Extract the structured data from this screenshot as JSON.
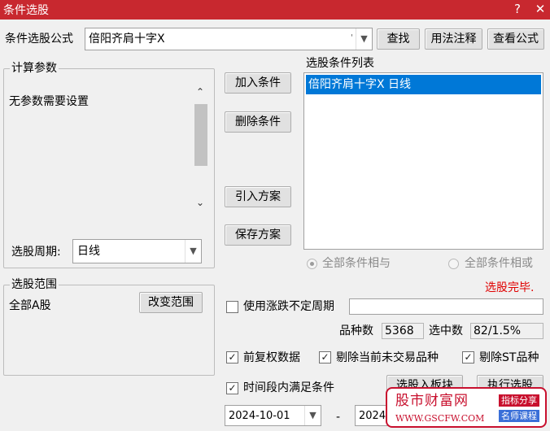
{
  "window": {
    "title": "条件选股",
    "help": "?",
    "close": "✕"
  },
  "formula": {
    "label": "条件选股公式",
    "value": "倍阳齐肩十字X",
    "find": "查找",
    "usage": "用法注释",
    "view": "查看公式"
  },
  "params": {
    "title": "计算参数",
    "text": "无参数需要设置",
    "period_label": "选股周期:",
    "period_value": "日线"
  },
  "actions": {
    "add": "加入条件",
    "remove": "删除条件",
    "import": "引入方案",
    "save": "保存方案"
  },
  "conditions": {
    "title": "选股条件列表",
    "items": [
      "倍阳齐肩十字X  日线"
    ],
    "and_label": "全部条件相与",
    "or_label": "全部条件相或",
    "status": "选股完毕."
  },
  "range": {
    "title": "选股范围",
    "value": "全部A股",
    "change": "改变范围"
  },
  "options": {
    "use_limit_period": "使用涨跌不定周期",
    "stock_count_label": "品种数",
    "stock_count": "5368",
    "selected_label": "选中数",
    "selected": "82/1.5%",
    "adjusted": "前复权数据",
    "remove_untraded": "剔除当前未交易品种",
    "remove_st": "剔除ST品种",
    "time_range": "时间段内满足条件",
    "to_block": "选股入板块",
    "execute": "执行选股",
    "date_from": "2024-10-01",
    "date_sep": "-",
    "date_to": "2024-"
  },
  "watermark": {
    "brand": "股市财富网",
    "url": "WWW.GSCFW.COM",
    "tag1": "指标分享",
    "tag2": "名师课程"
  },
  "colors": {
    "title_bar": "#c8282f",
    "selection": "#0078d7",
    "status": "#e00000",
    "watermark_red": "#c8102e",
    "watermark_blue": "#3a6fd8"
  }
}
